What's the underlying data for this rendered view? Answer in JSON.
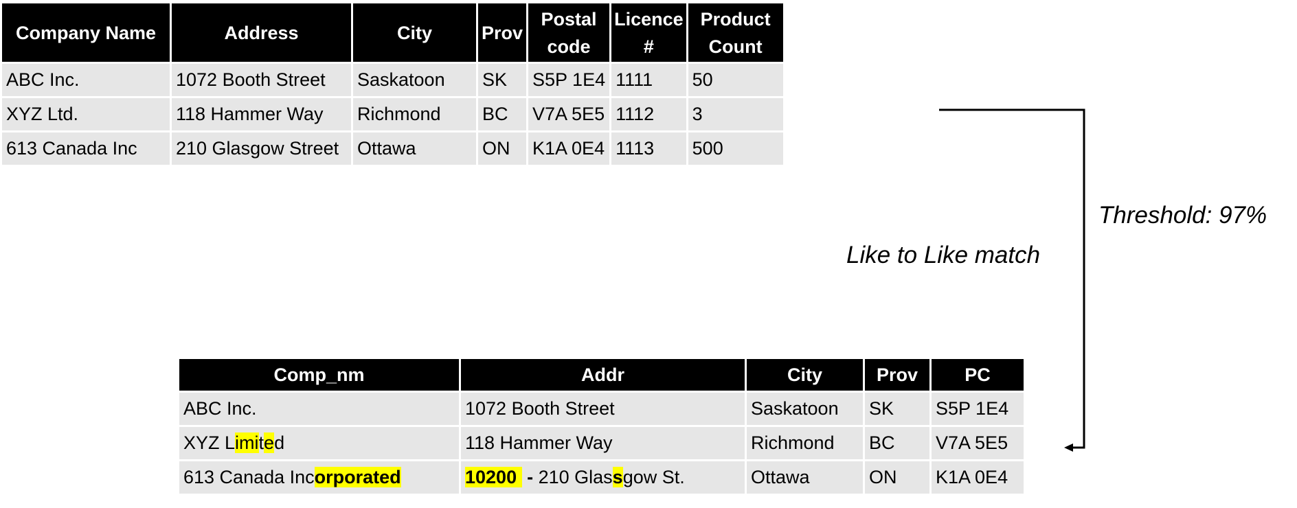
{
  "source_table": {
    "headers": [
      "Company Name",
      "Address",
      "City",
      "Prov",
      "Postal code",
      "Licence #",
      "Product Count"
    ],
    "rows": [
      [
        "ABC Inc.",
        "1072 Booth Street",
        "Saskatoon",
        "SK",
        "S5P 1E4",
        "1111",
        "50"
      ],
      [
        "XYZ Ltd.",
        "118 Hammer Way",
        "Richmond",
        "BC",
        "V7A 5E5",
        "1112",
        "3"
      ],
      [
        "613 Canada Inc",
        "210 Glasgow Street",
        "Ottawa",
        "ON",
        "K1A 0E4",
        "1113",
        "500"
      ]
    ]
  },
  "target_table": {
    "headers": [
      "Comp_nm",
      "Addr",
      "City",
      "Prov",
      "PC"
    ],
    "rows": [
      {
        "comp_nm": [
          {
            "text": "ABC Inc.",
            "style": "plain"
          }
        ],
        "addr": [
          {
            "text": "1072 Booth Street",
            "style": "plain"
          }
        ],
        "city": "Saskatoon",
        "prov": "SK",
        "pc": "S5P 1E4"
      },
      {
        "comp_nm": [
          {
            "text": "XYZ L",
            "style": "plain"
          },
          {
            "text": "imi",
            "style": "hl"
          },
          {
            "text": "t",
            "style": "plain"
          },
          {
            "text": "e",
            "style": "hl"
          },
          {
            "text": "d",
            "style": "plain"
          }
        ],
        "addr": [
          {
            "text": "118 Hammer Way",
            "style": "plain"
          }
        ],
        "city": "Richmond",
        "prov": "BC",
        "pc": "V7A 5E5"
      },
      {
        "comp_nm": [
          {
            "text": "613 Canada Inc",
            "style": "plain"
          },
          {
            "text": "orporated",
            "style": "hl-bold"
          }
        ],
        "addr": [
          {
            "text": "10200 ",
            "style": "hl-bold"
          },
          {
            "text": " - ",
            "style": "bold"
          },
          {
            "text": "210 Glas",
            "style": "plain"
          },
          {
            "text": "s",
            "style": "hl-bold"
          },
          {
            "text": "gow St.",
            "style": "plain"
          }
        ],
        "city": "Ottawa",
        "prov": "ON",
        "pc": "K1A 0E4"
      }
    ]
  },
  "annotations": {
    "threshold": "Threshold: 97%",
    "match_type": "Like to Like match"
  },
  "colors": {
    "header_bg": "#000000",
    "header_text": "#ffffff",
    "cell_bg": "#e6e6e6",
    "highlight": "#ffff00",
    "connector": "#000000"
  }
}
